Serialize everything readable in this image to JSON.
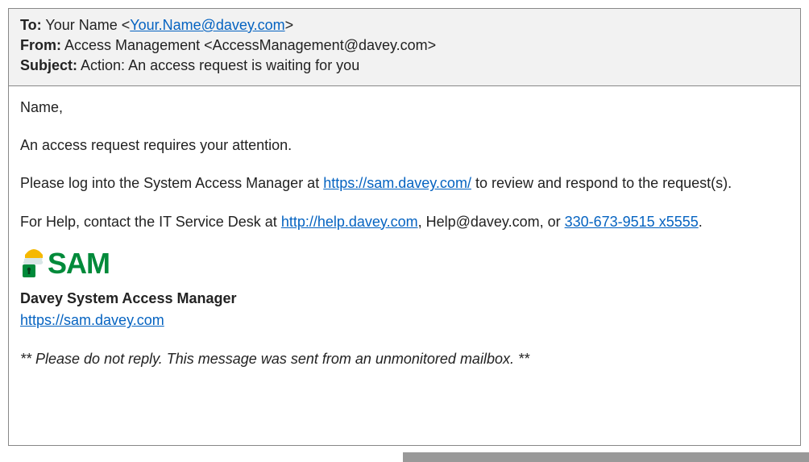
{
  "header": {
    "to_label": "To:",
    "to_name": "Your Name <",
    "to_email": "Your.Name@davey.com",
    "to_close": ">",
    "from_label": "From:",
    "from_value": "Access Management <AccessManagement@davey.com>",
    "subject_label": "Subject:",
    "subject_value": "Action: An access request is waiting for you"
  },
  "body": {
    "greeting": "Name,",
    "line1": "An access request requires your attention.",
    "line2a": "Please log into the System Access Manager at ",
    "sam_url": "https://sam.davey.com/",
    "line2b": " to review and respond to the request(s).",
    "line3a": "For Help, contact the IT Service Desk at ",
    "help_url": "http://help.davey.com",
    "line3b": ", Help@davey.com, or ",
    "phone": "330-673-9515 x5555",
    "line3c": "."
  },
  "signature": {
    "logo_text": "SAM",
    "name": "Davey System Access Manager",
    "url": "https://sam.davey.com"
  },
  "footer": {
    "note": "** Please do not reply.  This message was sent from an unmonitored mailbox. **"
  }
}
